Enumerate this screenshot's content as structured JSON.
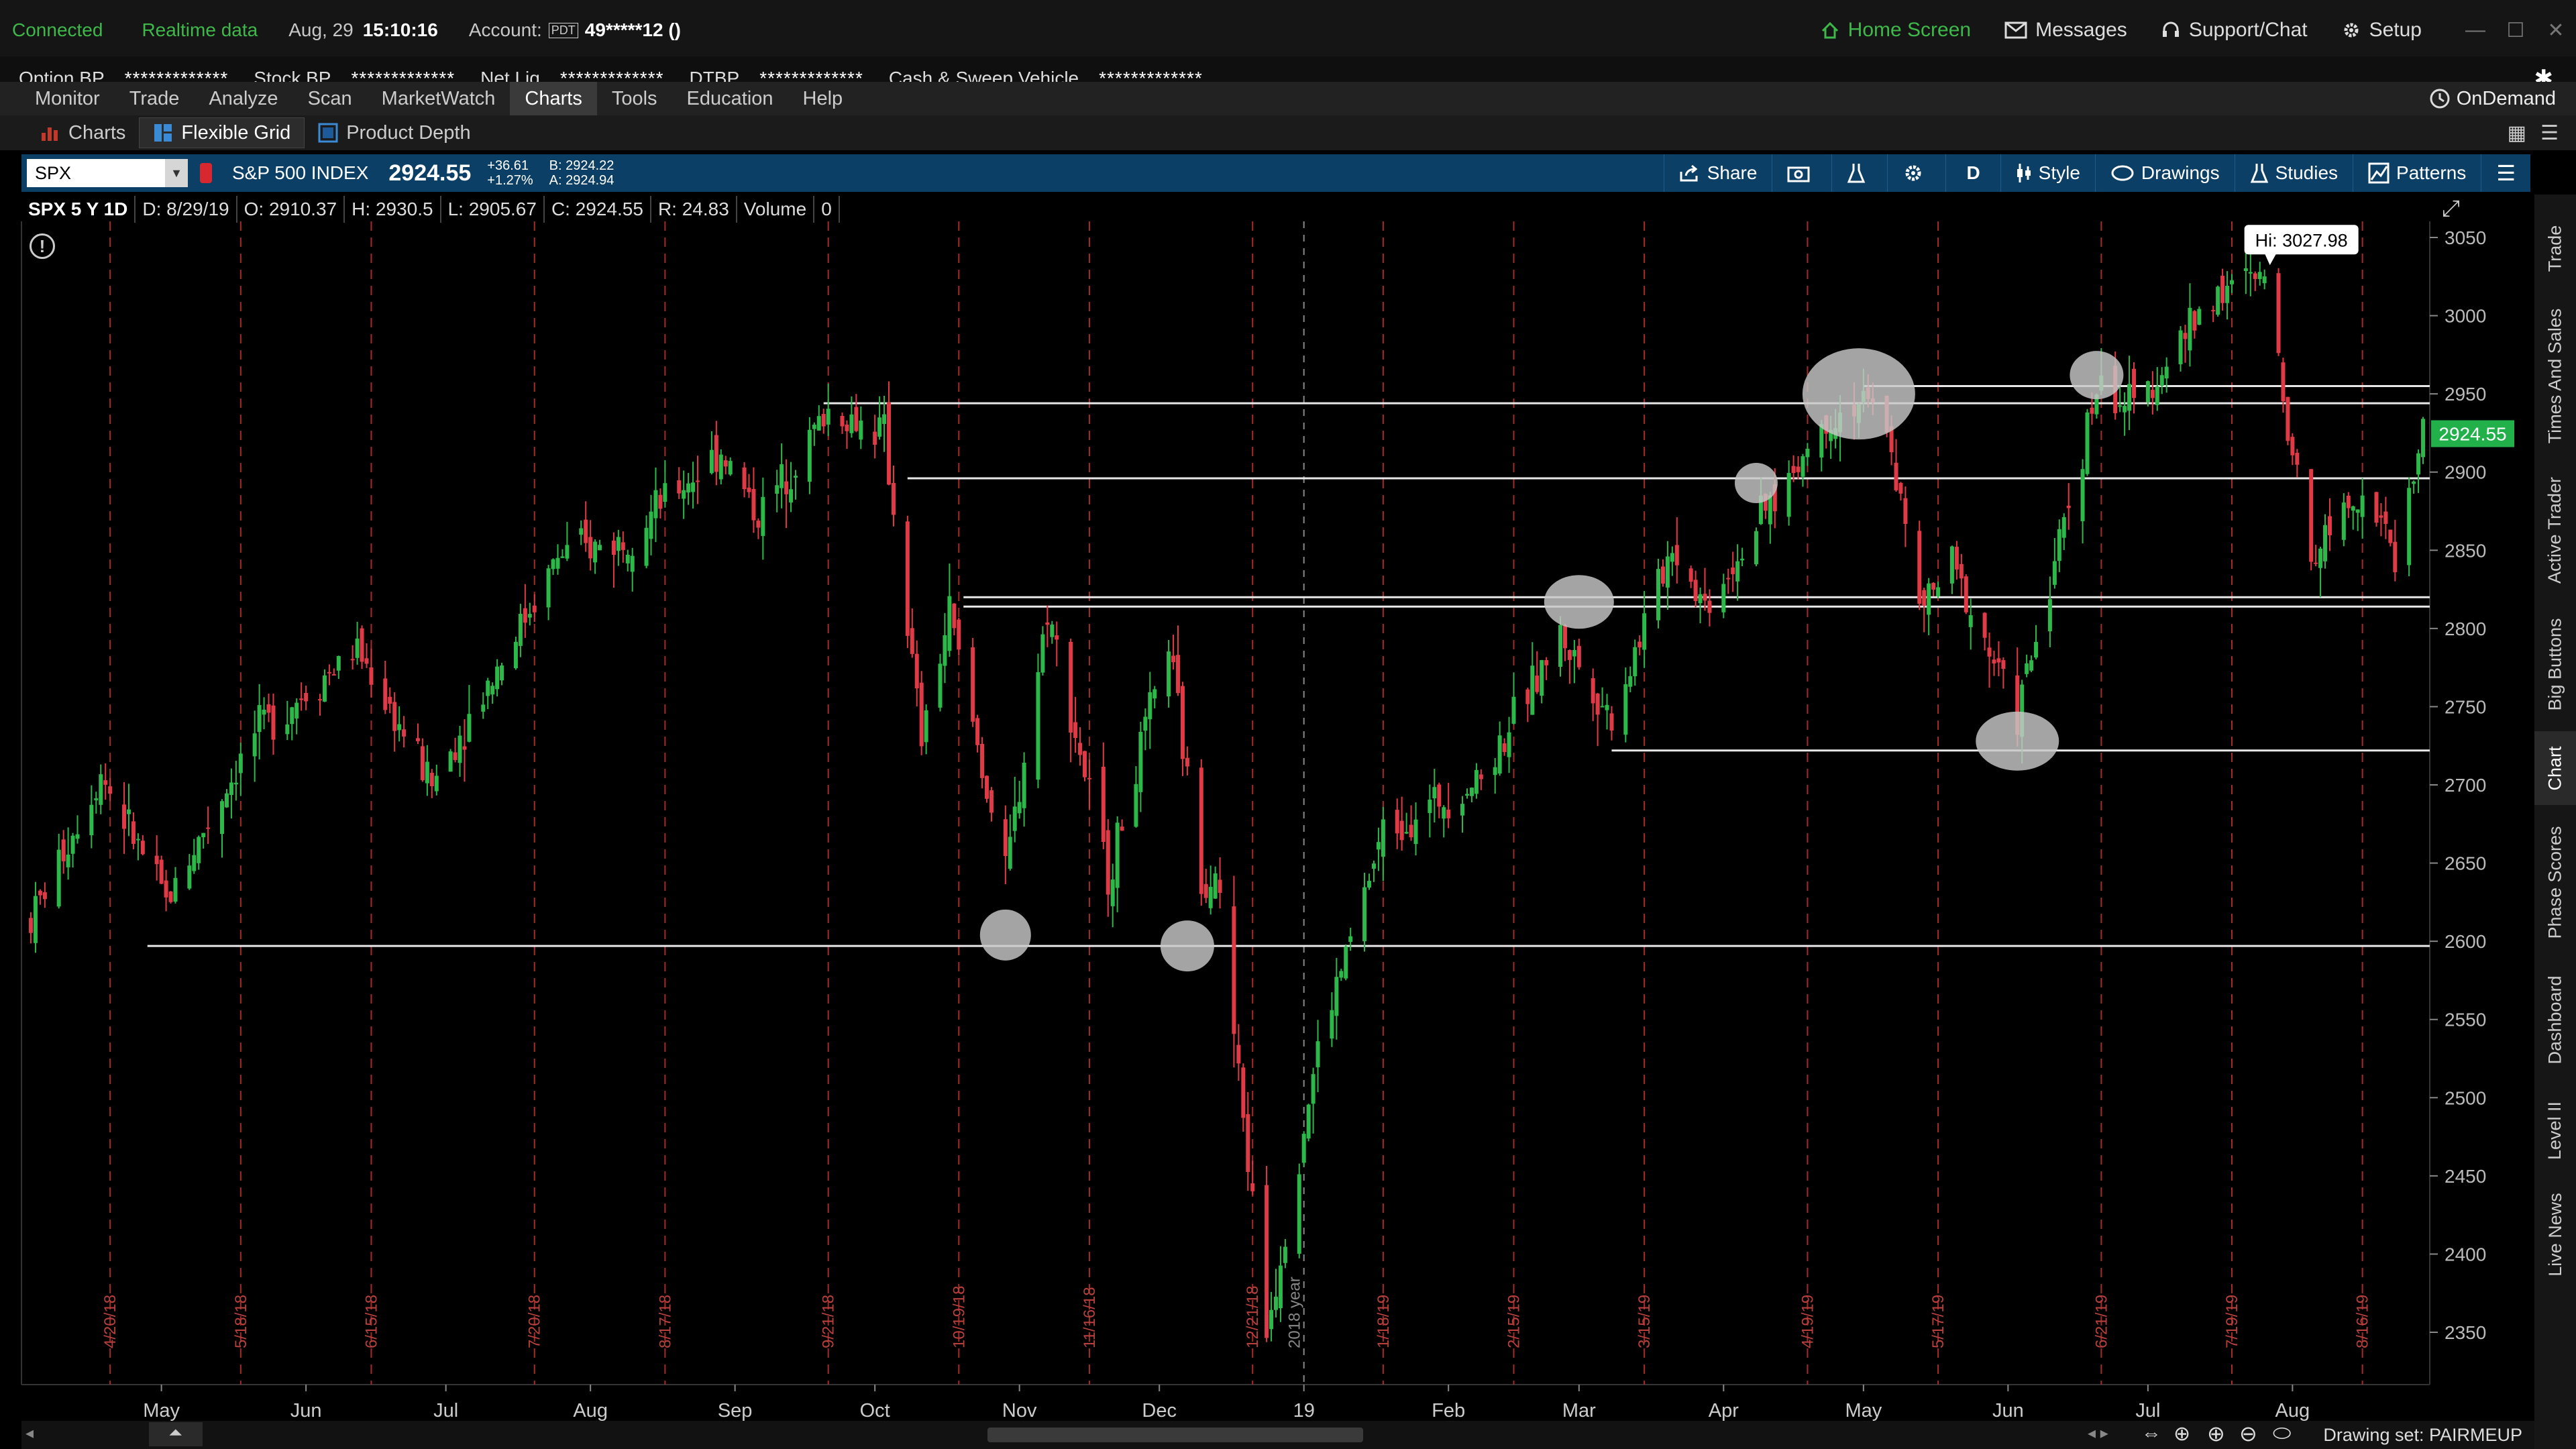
{
  "status": {
    "connection": "Connected",
    "data_mode": "Realtime data",
    "date": "Aug, 29",
    "time": "15:10:16",
    "account_label": "Account:",
    "account_badge": "PDT",
    "account_number": "49*****12 ()"
  },
  "top_nav": {
    "home": "Home Screen",
    "messages": "Messages",
    "support": "Support/Chat",
    "setup": "Setup"
  },
  "balances": [
    {
      "label": "Option BP",
      "value": "*************"
    },
    {
      "label": "Stock BP",
      "value": "*************"
    },
    {
      "label": "Net Liq",
      "value": "*************"
    },
    {
      "label": "DTBP",
      "value": "*************"
    },
    {
      "label": "Cash & Sweep Vehicle",
      "value": "*************"
    }
  ],
  "menu": [
    "Monitor",
    "Trade",
    "Analyze",
    "Scan",
    "MarketWatch",
    "Charts",
    "Tools",
    "Education",
    "Help"
  ],
  "menu_active": "Charts",
  "ondemand": "OnDemand",
  "subtabs": [
    "Charts",
    "Flexible Grid",
    "Product Depth"
  ],
  "chart_toolbar": {
    "symbol": "SPX",
    "name": "S&P 500 INDEX",
    "last": "2924.55",
    "change": "+36.61",
    "change_pct": "+1.27%",
    "bid": "B: 2924.22",
    "ask": "A: 2924.94",
    "share": "Share",
    "period": "D",
    "style": "Style",
    "drawings": "Drawings",
    "studies": "Studies",
    "patterns": "Patterns"
  },
  "ohlc": {
    "title": "SPX 5 Y 1D",
    "date": "D: 8/29/19",
    "open": "O: 2910.37",
    "high": "H: 2930.5",
    "low": "L: 2905.67",
    "close": "C: 2924.55",
    "range": "R: 24.83",
    "volume_label": "Volume",
    "volume": "0"
  },
  "price_labels": {
    "hi": "Hi: 3027.98",
    "last": "2924.55"
  },
  "y_ticks": [
    "3050",
    "3000",
    "2950",
    "2900",
    "2850",
    "2800",
    "2750",
    "2700",
    "2650",
    "2600",
    "2550",
    "2500",
    "2450",
    "2400",
    "2350"
  ],
  "month_labels": [
    "May",
    "Jun",
    "Jul",
    "Aug",
    "Sep",
    "Oct",
    "Nov",
    "Dec",
    "19",
    "Feb",
    "Mar",
    "Apr",
    "May",
    "Jun",
    "Jul",
    "Aug"
  ],
  "date_markers": [
    "4/20/18",
    "5/18/18",
    "6/15/18",
    "7/20/18",
    "8/17/18",
    "9/21/18",
    "10/19/18",
    "11/16/18",
    "12/21/18",
    "1/18/19",
    "2/15/19",
    "3/15/19",
    "4/19/19",
    "5/17/19",
    "6/21/19",
    "7/19/19",
    "8/16/19"
  ],
  "year_marker": "2018 year",
  "side_tabs": [
    "Trade",
    "Times And Sales",
    "Active Trader",
    "Big Buttons",
    "Chart",
    "Phase Scores",
    "Dashboard",
    "Level II",
    "Live News"
  ],
  "drawing_set": "Drawing set: PAIRMEUP",
  "colors": {
    "up": "#2db84a",
    "down": "#e03a46",
    "accent": "#0c3f66",
    "last_price": "#22b04a"
  },
  "chart_data": {
    "type": "candlestick",
    "symbol": "SPX",
    "y_range": [
      2330,
      3065
    ],
    "x_range": [
      "2018-04",
      "2019-08"
    ],
    "key_points": [
      {
        "x": "2018-09-21",
        "y": 2940
      },
      {
        "x": "2018-10-29",
        "y": 2603
      },
      {
        "x": "2018-12-24",
        "y": 2351
      },
      {
        "x": "2019-04-30",
        "y": 2954
      },
      {
        "x": "2019-06-03",
        "y": 2728
      },
      {
        "x": "2019-07-26",
        "y": 3028
      },
      {
        "x": "2019-08-29",
        "y": 2924.55
      }
    ],
    "horizontal_levels": [
      2597,
      2722,
      2814,
      2820,
      2896,
      2944,
      2955
    ]
  }
}
